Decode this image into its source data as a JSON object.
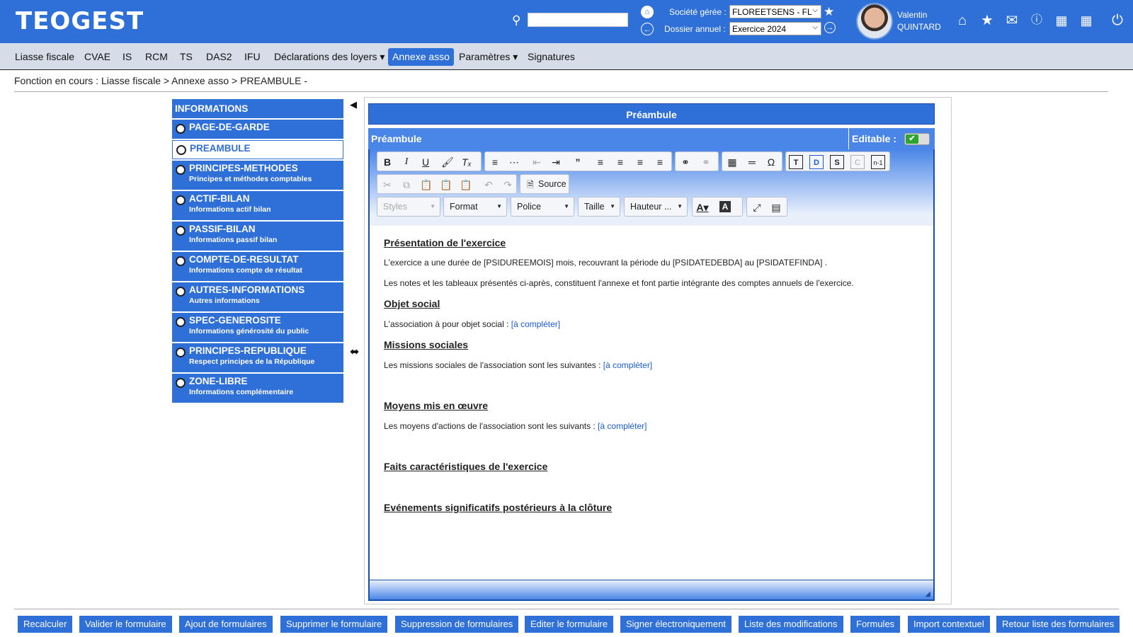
{
  "app": {
    "logo": "TEOGEST"
  },
  "header": {
    "societe_label": "Société gérée :",
    "societe_value": "FLOREETSENS - FL",
    "dossier_label": "Dossier annuel :",
    "dossier_value": "Exercice 2024",
    "user_first": "Valentin",
    "user_last": "QUINTARD",
    "icons": [
      "search-icon",
      "home-circle-icon",
      "back-circle-icon",
      "star-icon",
      "forward-circle-icon",
      "home-icon",
      "star-icon",
      "mail-icon",
      "help-icon",
      "calendar-icon",
      "apps-grid-icon",
      "power-icon"
    ]
  },
  "menu": {
    "items": [
      "Liasse fiscale",
      "CVAE",
      "IS",
      "RCM",
      "TS",
      "DAS2",
      "IFU",
      "Déclarations des loyers",
      "Annexe asso",
      "Paramètres",
      "Signatures"
    ],
    "active": "Annexe asso"
  },
  "breadcrumb": "Fonction en cours :  Liasse fiscale > Annexe asso > PREAMBULE -",
  "sidebar": {
    "header": "INFORMATIONS",
    "items": [
      {
        "title": "PAGE-DE-GARDE",
        "sub": ""
      },
      {
        "title": "PREAMBULE",
        "sub": ""
      },
      {
        "title": "PRINCIPES-METHODES",
        "sub": "Principes et méthodes comptables"
      },
      {
        "title": "ACTIF-BILAN",
        "sub": "Informations actif bilan"
      },
      {
        "title": "PASSIF-BILAN",
        "sub": "Informations passif bilan"
      },
      {
        "title": "COMPTE-DE-RESULTAT",
        "sub": "Informations compte de résultat"
      },
      {
        "title": "AUTRES-INFORMATIONS",
        "sub": "Autres informations"
      },
      {
        "title": "SPEC-GENEROSITE",
        "sub": "Informations générosité du public"
      },
      {
        "title": "PRINCIPES-REPUBLIQUE",
        "sub": "Respect principes de la République"
      },
      {
        "title": "ZONE-LIBRE",
        "sub": "Informations complémentaire"
      }
    ]
  },
  "panel": {
    "title": "Préambule",
    "section": "Préambule",
    "editable_label": "Editable :",
    "editable": true
  },
  "toolbar": {
    "source": "Source",
    "styles": "Styles",
    "format": "Format",
    "police": "Police",
    "taille": "Taille",
    "hauteur": "Hauteur ..."
  },
  "content": {
    "h1": "Présentation de l'exercice",
    "p1": "L'exercice a une durée de [PSIDUREEMOIS] mois, recouvrant la période du [PSIDATEDEBDA] au [PSIDATEFINDA] .",
    "p2": "Les notes et les tableaux présentés ci-après, constituent l'annexe et font partie intégrante des comptes annuels de l'exercice.",
    "h2": "Objet social",
    "p3": "L'association à pour objet social : ",
    "l3": "[à compléter]",
    "h3": "Missions sociales",
    "p4": "Les missions sociales de l'association sont les suivantes : ",
    "l4": "[à compléter]",
    "h4": "Moyens mis en œuvre",
    "p5": "Les moyens d'actions de l'association sont les suivants : ",
    "l5": "[à compléter]",
    "h5": "Faits caractéristiques de l'exercice",
    "h6": "Evénements significatifs postérieurs à la clôture"
  },
  "buttons": [
    "Recalculer",
    "Valider le formulaire",
    "Ajout de formulaires",
    "Supprimer le formulaire",
    "Suppression de formulaires",
    "Editer le formulaire",
    "Signer électroniquement",
    "Liste des modifications",
    "Formules",
    "Import contextuel",
    "Retour liste des formulaires"
  ]
}
